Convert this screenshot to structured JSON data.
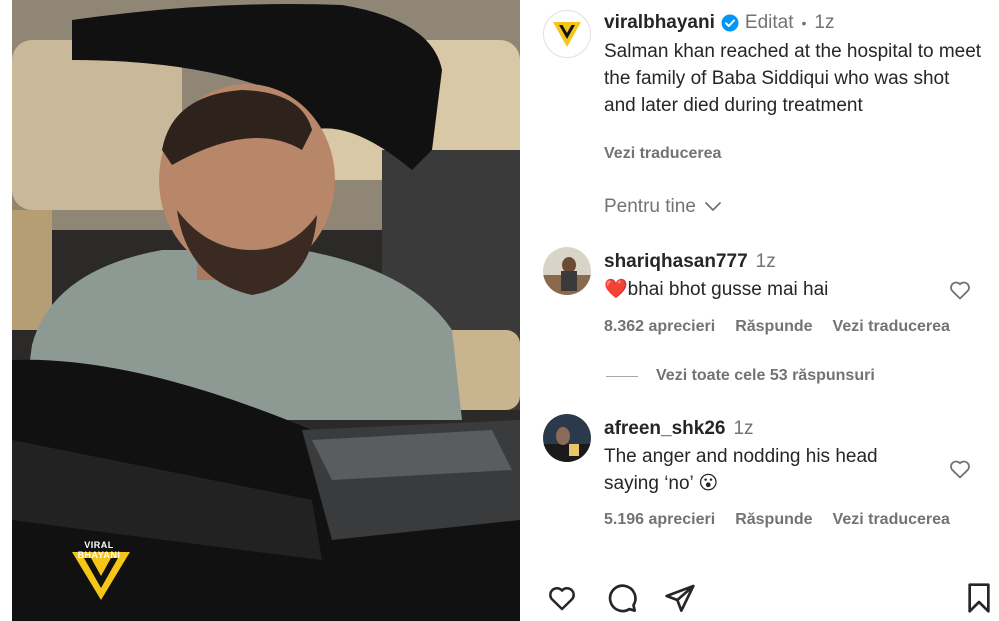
{
  "media": {
    "watermark_text": "VIRAL BHAYANI"
  },
  "post": {
    "username": "viralbhayani",
    "edited_label": "Editat",
    "separator": "•",
    "time": "1z",
    "caption": "Salman khan reached at the hospital to meet the family of Baba Siddiqui who was shot and later died during treatment",
    "see_translation": "Vezi traducerea"
  },
  "filter": {
    "label": "Pentru tine"
  },
  "comments": [
    {
      "username": "shariqhasan777",
      "time": "1z",
      "emoji": "❤️",
      "text": "bhai bhot gusse mai hai",
      "likes": "8.362 aprecieri",
      "reply": "Răspunde",
      "translate": "Vezi traducerea",
      "view_replies": "Vezi toate cele 53 răspunsuri"
    },
    {
      "username": "afreen_shk26",
      "time": "1z",
      "text": "The anger and nodding his head saying ‘no’",
      "emoji": "😮",
      "likes": "5.196 aprecieri",
      "reply": "Răspunde",
      "translate": "Vezi traducerea"
    }
  ],
  "colors": {
    "accent_yellow": "#f5c518",
    "verified_blue": "#0095f6",
    "muted": "#737373",
    "heart_red": "#e0245e"
  },
  "icons": [
    "verified-icon",
    "chevron-down-icon",
    "like-icon",
    "comment-icon",
    "share-icon",
    "save-icon"
  ]
}
